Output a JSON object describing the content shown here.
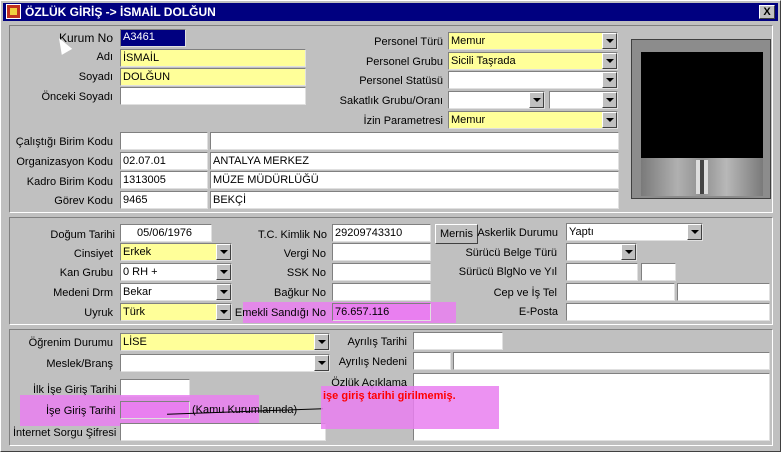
{
  "window": {
    "title": "ÖZLÜK GİRİŞ -> İSMAİL DOLĞUN",
    "close_label": "X"
  },
  "personal": {
    "kurum_no_label": "Kurum No",
    "kurum_no": "A3461",
    "adi_label": "Adı",
    "adi": "İSMAİL",
    "soyadi_label": "Soyadı",
    "soyadi": "DOLĞUN",
    "onceki_soyadi_label": "Önceki Soyadı",
    "onceki_soyadi": "",
    "personel_turu_label": "Personel Türü",
    "personel_turu": "Memur",
    "personel_grubu_label": "Personel Grubu",
    "personel_grubu": "Sicili Taşrada",
    "personel_statusu_label": "Personel Statüsü",
    "personel_statusu": "",
    "sakatlik_label": "Sakatlık Grubu/Oranı",
    "sakatlik_grubu": "",
    "sakatlik_orani": "",
    "izin_label": "İzin Parametresi",
    "izin": "Memur"
  },
  "units": {
    "calistigi_label": "Çalıştığı Birim  Kodu",
    "calistigi_kod": "",
    "calistigi_ad": "",
    "org_label": "Organizasyon Kodu",
    "org_kod": "02.07.01",
    "org_ad": "ANTALYA MERKEZ",
    "kadro_label": "Kadro Birim  Kodu",
    "kadro_kod": "1313005",
    "kadro_ad": "MÜZE MÜDÜRLÜĞÜ",
    "gorev_label": "Görev Kodu",
    "gorev_kod": "9465",
    "gorev_ad": "BEKÇİ"
  },
  "identity": {
    "dogum_label": "Doğum Tarihi",
    "dogum": "05/06/1976",
    "tc_label": "T.C. Kimlik No",
    "tc": "29209743310",
    "mernis_label": "Mernis",
    "askerlik_label": "Askerlik Durumu",
    "askerlik": "Yaptı",
    "cinsiyet_label": "Cinsiyet",
    "cinsiyet": "Erkek",
    "vergi_label": "Vergi No",
    "vergi": "",
    "surucu_turu_label": "Sürücü Belge Türü",
    "surucu_turu": "",
    "kan_label": "Kan Grubu",
    "kan": "0 RH +",
    "ssk_label": "SSK No",
    "ssk": "",
    "surucu_no_label": "Sürücü BlgNo ve Yıl",
    "surucu_no": "",
    "surucu_yil": "",
    "medeni_label": "Medeni Drm",
    "medeni": "Bekar",
    "bagkur_label": "Bağkur No",
    "bagkur": "",
    "cep_label": "Cep ve İş Tel",
    "cep": "",
    "is_tel": "",
    "uyruk_label": "Uyruk",
    "uyruk": "Türk",
    "emekli_label": "Emekli Sandığı No",
    "emekli": "76.657.116",
    "eposta_label": "E-Posta",
    "eposta": ""
  },
  "education": {
    "ogrenim_label": "Öğrenim Durumu",
    "ogrenim": "LİSE",
    "meslek_label": "Meslek/Branş",
    "meslek": "",
    "ayrilis_tarihi_label": "Ayrılış Tarihi",
    "ayrilis_tarihi": "",
    "ayrilis_nedeni_label": "Ayrılış Nedeni",
    "ayrilis_nedeni_kod": "",
    "ayrilis_nedeni": "",
    "ozluk_aciklama_label": "Özlük Açıklama",
    "ozluk_aciklama": "",
    "ilk_ise_label": "İlk İşe Giriş Tarihi",
    "ilk_ise": "",
    "ise_giris_label": "İşe Giriş Tarihi",
    "ise_giris": "",
    "kamu_note": "(Kamu Kurumlarında)",
    "internet_label": "İnternet Sorgu Şifresi",
    "internet": "",
    "warning": "işe giriş tarihi girilmemiş."
  },
  "colors": {
    "title_bar": "#000080",
    "required_field": "#ffff99",
    "highlight": "#e97ff0",
    "warning_text": "#ff0000"
  },
  "icons": {
    "app": "app-icon",
    "close": "close-icon",
    "dropdown": "chevron-down-icon"
  }
}
